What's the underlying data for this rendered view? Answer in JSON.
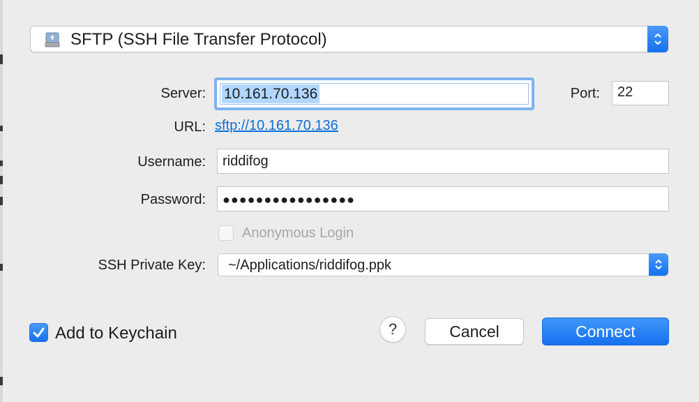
{
  "protocol": {
    "selected": "SFTP (SSH File Transfer Protocol)",
    "icon": "network-drive-icon"
  },
  "server": {
    "label": "Server:",
    "value": "10.161.70.136"
  },
  "port": {
    "label": "Port:",
    "value": "22"
  },
  "url": {
    "label": "URL:",
    "value": "sftp://10.161.70.136"
  },
  "username": {
    "label": "Username:",
    "value": "riddifog"
  },
  "password": {
    "label": "Password:",
    "masked": "●●●●●●●●●●●●●●●●"
  },
  "anonymous": {
    "label": "Anonymous Login",
    "checked": false,
    "enabled": false
  },
  "ssh_key": {
    "label": "SSH Private Key:",
    "selected": "~/Applications/riddifog.ppk"
  },
  "keychain": {
    "label": "Add to Keychain",
    "checked": true
  },
  "buttons": {
    "help": "?",
    "cancel": "Cancel",
    "connect": "Connect"
  },
  "colors": {
    "accent": "#1a73ee",
    "link": "#0b6fd8",
    "selection": "#b2d7ff"
  }
}
